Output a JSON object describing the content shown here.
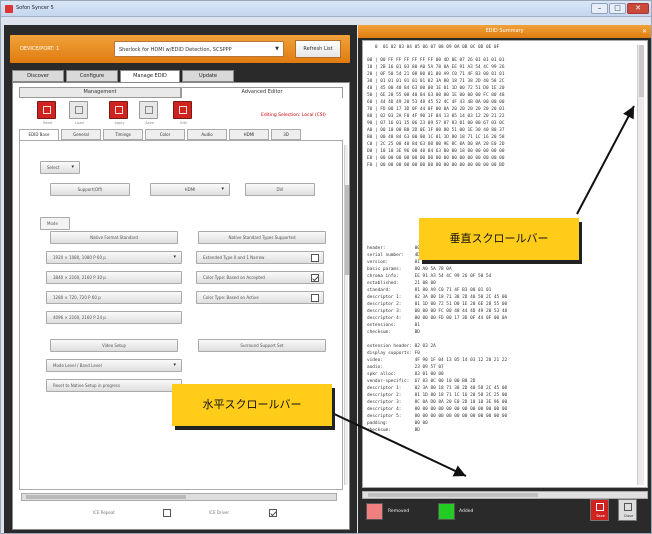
{
  "window": {
    "title": "Sofon Syncer 5",
    "minimize": "–",
    "maximize": "□",
    "close": "✕"
  },
  "topbar": {
    "device_label": "DEVICE/PORT: 1",
    "selected_device": "Sherlock for HDMI w/EDID Detection, SCSPPP",
    "refresh_label": "Refresh List"
  },
  "main_tabs": [
    "Discover",
    "Configure",
    "Manage EDID",
    "Update"
  ],
  "sub_tabs": [
    "Management",
    "Advanced Editor"
  ],
  "toolbar": [
    {
      "label": "Read",
      "style": "red"
    },
    {
      "label": "Load",
      "style": "grey"
    },
    {
      "label": "Apply",
      "style": "red"
    },
    {
      "label": "Save",
      "style": "grey"
    },
    {
      "label": "Edit",
      "style": "red"
    }
  ],
  "editing_status": "Editing Selection: Local (CSI)",
  "editor_tabs": [
    "EDID Base",
    "General",
    "Timings",
    "Color",
    "Audio",
    "HDMI",
    "3D"
  ],
  "form": {
    "select1": "Select",
    "support_label": "Support(Off)",
    "hdmi_select": "HDMI",
    "dvi_label": "DVI",
    "mode_label": "Mode",
    "btn_std": "Native Format Standard",
    "btn_cfg": "Native Standard Types Supported",
    "res1": "1920 × 1080, 1080 P 60 p",
    "res1b": "Extended Type 0 and 1 Narrow",
    "res2": "3840 × 2160, 2160 P 30 p",
    "res2b": "Color Type: Based on Accepted",
    "res3": "1280 × 720, 720 P 60 p",
    "res3b": "Color Type: Based on Active",
    "res4": "4096 × 2160, 2160 P 24 p",
    "btn_video": "Video Setup",
    "btn_audio": "Surround Support Set",
    "sel_mode": "Mode Level / Band Level",
    "sel_mode2": "Mode Level / Band Level",
    "reset_label": "Reset to Native Setup in progress"
  },
  "bottom_checks": [
    "ICE Repeat",
    "ICE Driver"
  ],
  "edid_panel": {
    "title": "EDID Summary",
    "close": "✕",
    "hex_header": "   0  01 02 03 04 05 06 07 08 09 0A 0B 0C 0D 0E 0F",
    "hex_rows": [
      "00 | 00 FF FF FF FF FF FF 00 4D 8E 07 26 01 01 01 01",
      "10 | 2B 16 01 03 80 A0 5A 78 0A EE 91 A3 54 4C 99 26",
      "20 | 0F 50 54 21 08 00 81 80 A9 C0 71 4F B3 00 01 01",
      "30 | 01 01 01 01 01 01 02 3A 80 18 71 38 2D 40 58 2C",
      "40 | 45 00 40 84 63 00 00 1E 01 1D 00 72 51 D0 1E 20",
      "50 | 6E 28 55 00 40 84 63 00 00 1E 00 00 00 FC 00 48",
      "60 | 44 4D 49 20 53 48 45 52 4C 4F 43 4B 0A 00 00 00",
      "70 | FD 00 17 3D 0F 44 0F 00 0A 20 20 20 20 20 20 01",
      "80 | 02 03 2A F0 4F 90 1F 04 13 05 14 03 12 20 21 22",
      "90 | 07 16 01 15 06 23 09 57 07 83 01 00 00 67 03 0C",
      "A0 | 00 10 00 B8 2D 0E 1F 00 80 51 00 1E 30 40 80 37",
      "B0 | 00 40 84 63 00 00 1C 01 1D 80 18 71 1C 16 20 58",
      "C0 | 2C 25 00 40 84 63 00 00 9E 8C 0A D0 8A 20 E0 2D",
      "D0 | 10 10 3E 96 00 40 84 63 00 00 18 00 00 00 00 00",
      "E0 | 00 00 00 00 00 00 00 00 00 00 00 00 00 00 00 00",
      "F0 | 00 00 00 00 00 00 00 00 00 00 00 00 00 00 00 BD"
    ],
    "decoded": [
      "header:           00 FF FF FF FF FF FF 00",
      "serial number:    4D 8E 07 26 01 01 01 01",
      "version:          01 03",
      "basic params:     80 A0 5A 78 0A",
      "chroma info:      EE 91 A3 54 4C 99 26 0F 50 54",
      "established:      21 08 00",
      "standard:         81 80 A9 C0 71 4F B3 00 01 01",
      "descriptor 1:     02 3A 80 18 71 38 2D 40 58 2C 45 00",
      "descriptor 2:     01 1D 00 72 51 D0 1E 20 6E 28 55 00",
      "descriptor 3:     00 00 00 FC 00 48 44 4D 49 20 53 48",
      "descriptor 4:     00 00 00 FD 00 17 3D 0F 44 0F 00 0A",
      "extensions:       01",
      "checksum:         BD",
      "",
      "extension header: 02 03 2A",
      "display supports: F0",
      "video:            4F 90 1F 04 13 05 14 03 12 20 21 22",
      "audio:            23 09 57 07",
      "spkr alloc:       83 01 00 00",
      "vendor-specific:  67 03 0C 00 10 00 B8 2D",
      "descriptor 1:     02 3A 80 18 71 38 2D 40 58 2C 45 00",
      "descriptor 2:     01 1D 80 18 71 1C 16 20 58 2C 25 00",
      "descriptor 3:     8C 0A D0 8A 20 E0 2D 10 10 3E 96 00",
      "descriptor 4:     00 00 00 00 00 00 00 00 00 00 00 00",
      "descriptor 5:     00 00 00 00 00 00 00 00 00 00 00 00",
      "padding:          00 00",
      "checksum:         BD"
    ],
    "legend_removed": "Removed",
    "legend_added": "Added",
    "btn_save": "Save",
    "btn_close": "Close"
  },
  "annotations": {
    "vertical": "垂直スクロールバー",
    "horizontal": "水平スクロールバー"
  },
  "colors": {
    "accent_orange": "#e8901f",
    "removed": "#f08080",
    "added": "#22cc22",
    "callout": "#ffcc1a",
    "button_red": "#d0231f"
  }
}
